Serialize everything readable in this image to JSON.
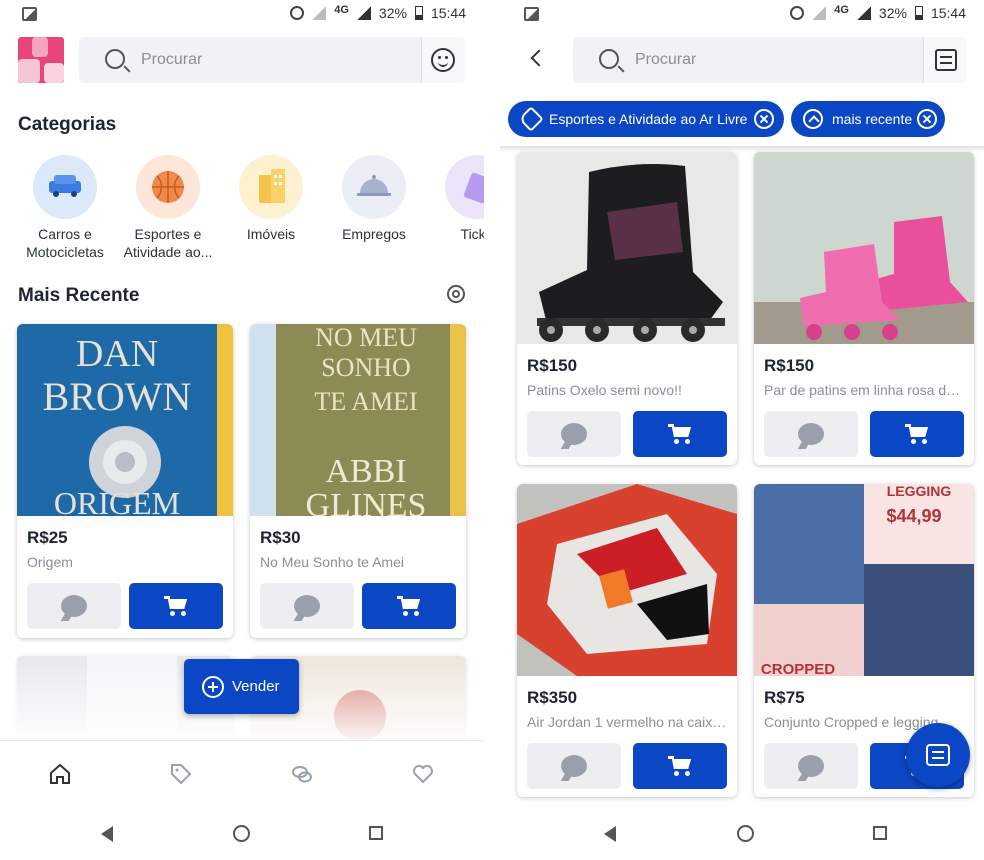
{
  "status": {
    "network": "4G",
    "battery": "32%",
    "time": "15:44"
  },
  "left": {
    "search_placeholder": "Procurar",
    "categories_heading": "Categorias",
    "categories": [
      {
        "label": "Carros e Motocicletas",
        "icon": "car-icon",
        "color": "#dbe9fb"
      },
      {
        "label": "Esportes e Atividade ao...",
        "icon": "basketball-icon",
        "color": "#fde7d8"
      },
      {
        "label": "Imóveis",
        "icon": "building-icon",
        "color": "#fdf1cf"
      },
      {
        "label": "Empregos",
        "icon": "cloche-icon",
        "color": "#eceef7"
      },
      {
        "label": "Ticke",
        "icon": "ticket-icon",
        "color": "#ece4fb"
      }
    ],
    "recent_heading": "Mais Recente",
    "listings": [
      {
        "price": "R$25",
        "title": "Origem"
      },
      {
        "price": "R$30",
        "title": "No Meu Sonho te Amei"
      }
    ],
    "sell_label": "Vender"
  },
  "right": {
    "search_placeholder": "Procurar",
    "chips": [
      {
        "label": "Esportes e Atividade ao Ar Livre"
      },
      {
        "label": "mais recente"
      }
    ],
    "listings": [
      {
        "price": "R$150",
        "title": "Patins Oxelo semi novo!!"
      },
      {
        "price": "R$150",
        "title": "Par de patins em linha rosa da ..."
      },
      {
        "price": "R$350",
        "title": "Air Jordan 1 vermelho na caixa..."
      },
      {
        "price": "R$75",
        "title": "Conjunto Cropped e legging ..."
      }
    ]
  },
  "colors": {
    "primary": "#0b47c4",
    "muted_button": "#eceef2",
    "text_muted": "#8a8f98"
  }
}
